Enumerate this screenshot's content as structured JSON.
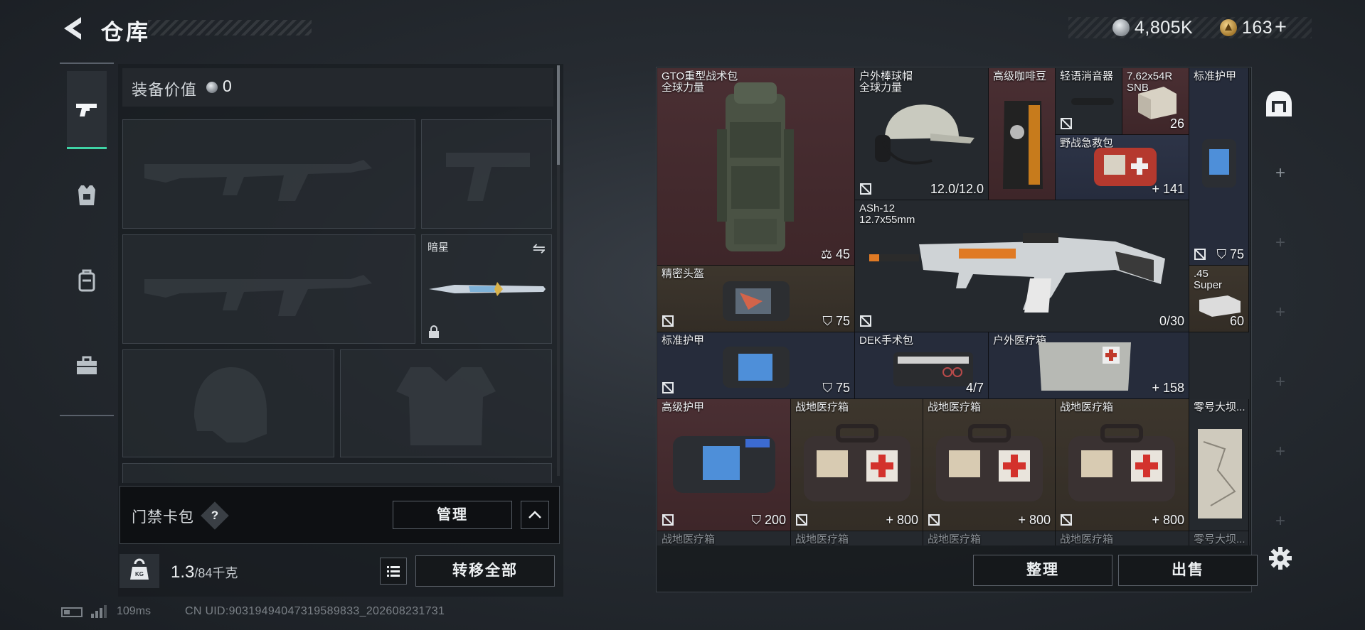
{
  "header": {
    "title": "仓库",
    "currency_silver": "4,805K",
    "currency_gold": "163",
    "currency_add": "+"
  },
  "tabs": [
    {
      "name": "weapons",
      "icon": "pistol-icon",
      "active": true
    },
    {
      "name": "armor",
      "icon": "armor-vest-icon",
      "active": false
    },
    {
      "name": "backpack",
      "icon": "backpack-icon",
      "active": false
    },
    {
      "name": "tools",
      "icon": "toolbox-icon",
      "active": false
    }
  ],
  "equipment": {
    "label": "装备价值",
    "value": "0",
    "knife_slot_title": "暗星",
    "access_card_label": "门禁卡包",
    "help": "?",
    "manage_label": "管理",
    "weight": "1.3",
    "weight_max": "/84千克",
    "transfer_all_label": "转移全部"
  },
  "stash": {
    "items": [
      {
        "name": "GTO重型战术包\n全球力量",
        "value": "45",
        "value_icon": "weight-icon"
      },
      {
        "name": "户外棒球帽\n全球力量",
        "value": "12.0/12.0"
      },
      {
        "name": "高级咖啡豆",
        "value": ""
      },
      {
        "name": "轻语消音器",
        "value": ""
      },
      {
        "name": "7.62x54R\nSNB",
        "value": "26"
      },
      {
        "name": "标准护甲",
        "value": ""
      },
      {
        "name": "野战急救包",
        "value": "+ 141"
      },
      {
        "name": "ASh-12\n12.7x55mm",
        "value": "0/30"
      },
      {
        "name": "",
        "value": "75",
        "value_icon": "shield-icon"
      },
      {
        "name": "精密头盔",
        "value": "75",
        "value_icon": "shield-icon"
      },
      {
        "name": ".45\nSuper",
        "value": "60"
      },
      {
        "name": "标准护甲",
        "value": "75",
        "value_icon": "shield-icon"
      },
      {
        "name": "DEK手术包",
        "value": "4/7"
      },
      {
        "name": "户外医疗箱",
        "value": "+ 158"
      },
      {
        "name": "高级护甲",
        "value": "200",
        "value_icon": "shield-icon"
      },
      {
        "name": "战地医疗箱",
        "value": "+ 800"
      },
      {
        "name": "战地医疗箱",
        "value": "+ 800"
      },
      {
        "name": "战地医疗箱",
        "value": "+ 800"
      },
      {
        "name": "零号大坝...",
        "value": ""
      },
      {
        "name": "战地医疗箱",
        "value": ""
      },
      {
        "name": "战地医疗箱",
        "value": ""
      },
      {
        "name": "战地医疗箱",
        "value": ""
      },
      {
        "name": "战地医疗箱",
        "value": ""
      },
      {
        "name": "零号大坝...",
        "value": ""
      }
    ],
    "sort_label": "整理",
    "sell_label": "出售",
    "rail_plus": "+"
  },
  "status": {
    "ping": "109ms",
    "uid": "CN UID:9031949404731958​9833_202608231731"
  },
  "colors": {
    "accent": "#3fd3a5",
    "rarity_red": "#4a2f33",
    "rarity_blue": "#2d3447",
    "rarity_brown": "#3d362d"
  }
}
